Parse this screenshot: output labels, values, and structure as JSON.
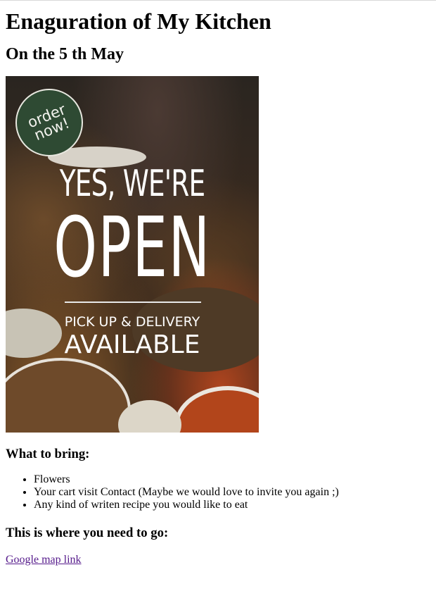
{
  "heading": "Enaguration of My Kitchen",
  "date": "On the 5 th May",
  "poster": {
    "badge": "order\nnow!",
    "line1": "YES, WE'RE",
    "line2": "OPEN",
    "line3": "PICK UP & DELIVERY",
    "line4": "AVAILABLE",
    "badge_color": "#2e4a33"
  },
  "bring_title": "What to bring:",
  "bring_items": [
    "Flowers",
    "Your cart visit Contact (Maybe we would love to invite you again ;)",
    "Any kind of writen recipe you would like to eat"
  ],
  "where_title": "This is where you need to go:",
  "map_link": "Google map link",
  "link_color": "#551a8b"
}
